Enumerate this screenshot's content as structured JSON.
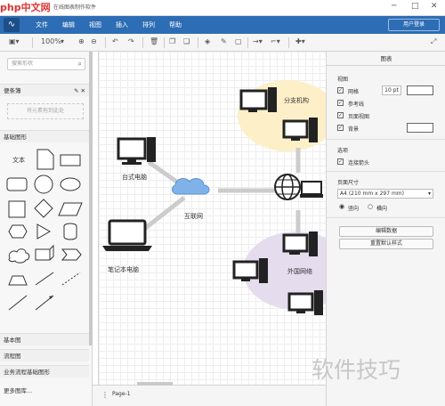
{
  "titlebar": {
    "title": "在线图表制作软件",
    "site_logo": "php中文网",
    "close": "✕",
    "min": "─",
    "max": "□"
  },
  "menu": {
    "items": [
      "文件",
      "编辑",
      "视图",
      "插入",
      "排列",
      "帮助"
    ],
    "user": "用户登录"
  },
  "toolbar": {
    "zoom": "100%"
  },
  "sidebar": {
    "search_placeholder": "搜索形状",
    "favorites": "便条簿",
    "drop_hint": "将元素拖到此处",
    "basic": "基础图形",
    "text_shape": "文本",
    "sections": [
      "基本图",
      "流程图",
      "业务流程基础图形",
      "更多图库..."
    ]
  },
  "canvas": {
    "labels": {
      "desktop": "台式电脑",
      "internet": "互联网",
      "laptop": "笔记本电脑",
      "branch": "分支机构",
      "foreign": "外国网络"
    }
  },
  "bottom": {
    "page": "Page-1"
  },
  "panel": {
    "title": "图表",
    "view": "视图",
    "grid": "网格",
    "grid_size": "10 pt",
    "guides": "参考线",
    "page_view": "页面视图",
    "background": "背景",
    "options": "选项",
    "connection_arrows": "连接箭头",
    "paper_size": "页面尺寸",
    "paper_value": "A4 (210 mm x 297 mm)",
    "portrait": "竖向",
    "landscape": "横向",
    "edit_data": "编辑数据",
    "reset_style": "重置默认样式"
  },
  "watermark": "软件技巧"
}
